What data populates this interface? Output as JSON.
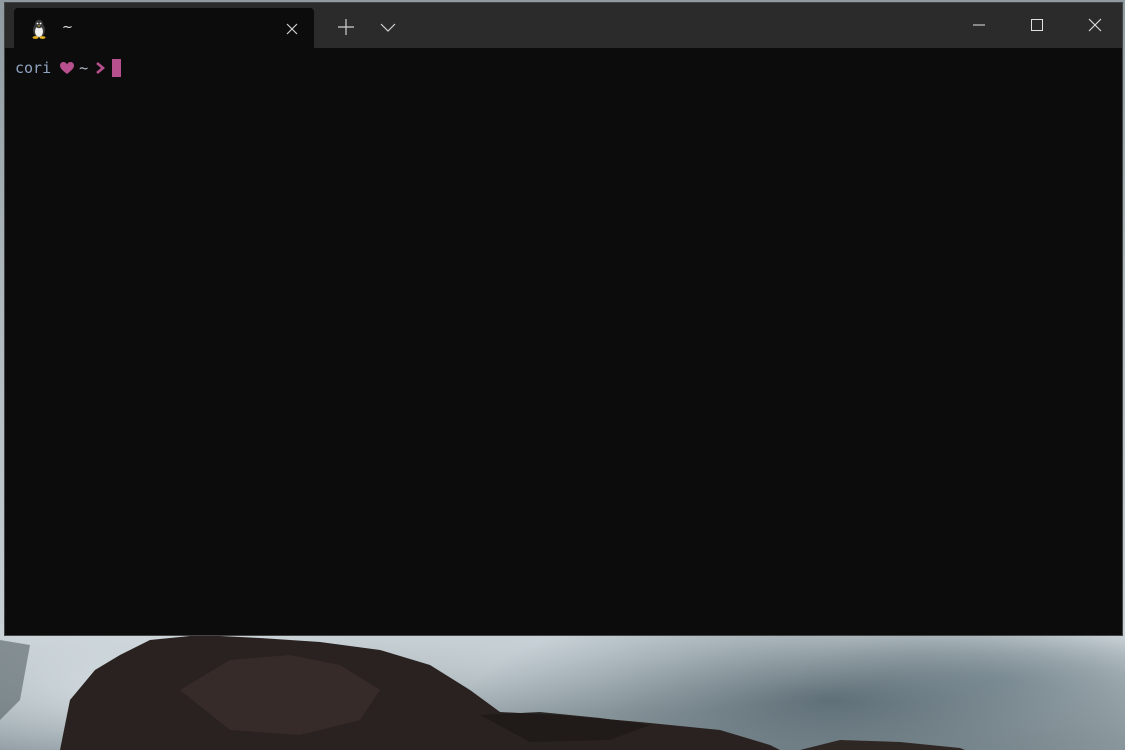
{
  "tab": {
    "title": "~",
    "icon": "linux-penguin-icon"
  },
  "titlebar": {
    "new_tab_icon": "plus-icon",
    "dropdown_icon": "chevron-down-icon",
    "minimize_icon": "minimize-icon",
    "maximize_icon": "maximize-icon",
    "close_icon": "close-icon"
  },
  "terminal": {
    "prompt_user": "cori",
    "prompt_dir": "~",
    "heart_icon": "heart-icon",
    "arrow_icon": "chevron-right-icon",
    "colors": {
      "background": "#0c0c0c",
      "accent": "#b8508e",
      "user_text": "#8fa3c0"
    }
  }
}
